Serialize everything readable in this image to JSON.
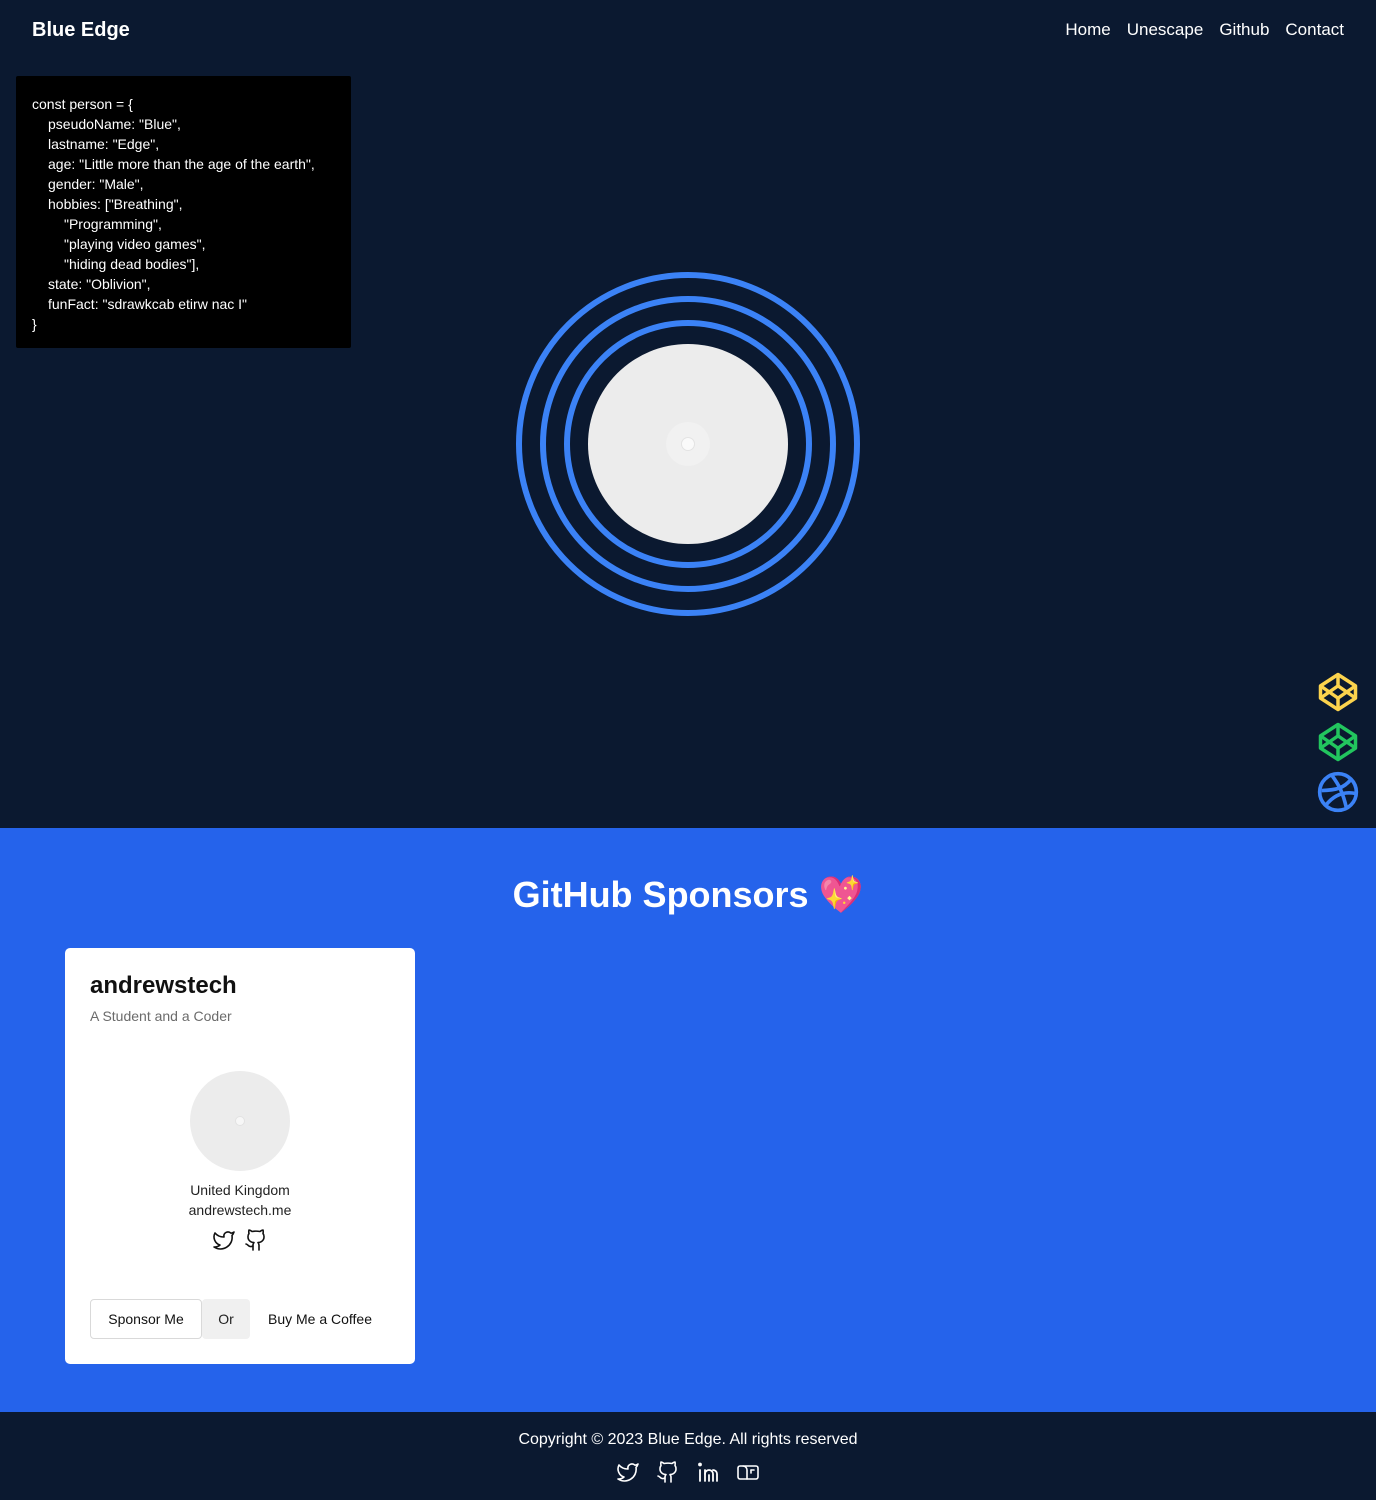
{
  "nav": {
    "brand": "Blue Edge",
    "links": [
      "Home",
      "Unescape",
      "Github",
      "Contact"
    ]
  },
  "hero": {
    "code_lines": [
      {
        "text": "const person = {",
        "indent": 0
      },
      {
        "text": "pseudoName: \"Blue\",",
        "indent": 1
      },
      {
        "text": "lastname: \"Edge\",",
        "indent": 1
      },
      {
        "text": "age: \"Little more than the age of the earth\",",
        "indent": 1
      },
      {
        "text": "gender: \"Male\",",
        "indent": 1
      },
      {
        "text": "hobbies: [\"Breathing\",",
        "indent": 1
      },
      {
        "text": "\"Programming\",",
        "indent": 2
      },
      {
        "text": "\"playing video games\",",
        "indent": 2
      },
      {
        "text": "\"hiding dead bodies\"],",
        "indent": 2
      },
      {
        "text": "state: \"Oblivion\",",
        "indent": 1
      },
      {
        "text": "funFact: \"sdrawkcab etirw nac I\"",
        "indent": 1
      },
      {
        "text": "}",
        "indent": 0
      }
    ],
    "ring_color": "#3b82f6",
    "side_icons": [
      {
        "name": "codepen-icon",
        "color": "#fcd34d"
      },
      {
        "name": "codepen-icon",
        "color": "#22c55e"
      },
      {
        "name": "dribbble-icon",
        "color": "#3b82f6"
      }
    ]
  },
  "sponsors": {
    "heading": "GitHub Sponsors 💖",
    "background": "#2563eb",
    "card": {
      "name": "andrewstech",
      "bio": "A Student and a Coder",
      "location": "United Kingdom",
      "website": "andrewstech.me",
      "socials": [
        "twitter-icon",
        "github-icon"
      ],
      "sponsor_label": "Sponsor Me",
      "or_label": "Or",
      "coffee_label": "Buy Me a Coffee"
    }
  },
  "footer": {
    "copyright": "Copyright © 2023 Blue Edge. All rights reserved",
    "icons": [
      "twitter-icon",
      "github-icon",
      "linkedin-icon",
      "mailbox-icon"
    ]
  },
  "colors": {
    "background": "#0b1930",
    "accent": "#3b82f6"
  }
}
